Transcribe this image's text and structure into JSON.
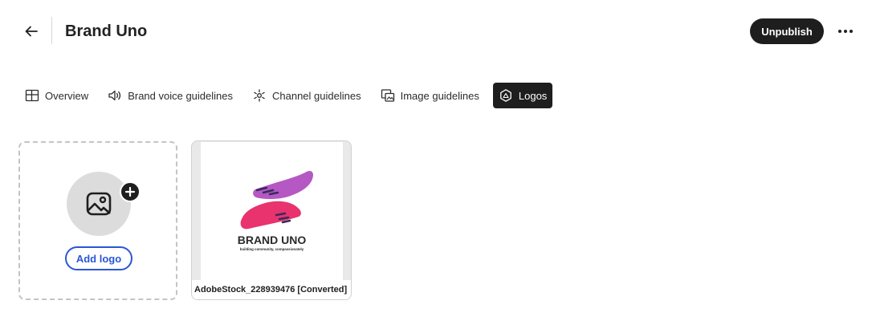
{
  "header": {
    "title": "Brand Uno",
    "publish_label": "Unpublish"
  },
  "tabs": [
    {
      "label": "Overview",
      "icon": "layout-icon",
      "active": false
    },
    {
      "label": "Brand voice guidelines",
      "icon": "speaker-icon",
      "active": false
    },
    {
      "label": "Channel guidelines",
      "icon": "channels-icon",
      "active": false
    },
    {
      "label": "Image guidelines",
      "icon": "images-icon",
      "active": false
    },
    {
      "label": "Logos",
      "icon": "logo-hexagon-icon",
      "active": true
    }
  ],
  "add_card": {
    "button_label": "Add logo"
  },
  "logos": [
    {
      "filename": "AdobeStock_228939476 [Converted]",
      "brand_text": "BRAND UNO",
      "tagline": "building community, compassionately"
    }
  ],
  "colors": {
    "accent_blue": "#2b56d4",
    "dark": "#1e1e1e",
    "logo_pink": "#e8336e",
    "logo_purple": "#b558c4"
  }
}
